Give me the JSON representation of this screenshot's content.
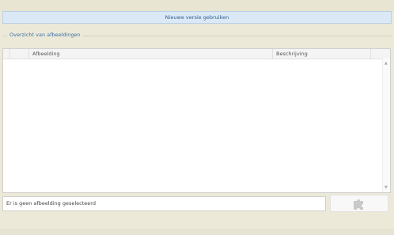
{
  "banner": {
    "label": "Nieuwe versie gebruiken"
  },
  "group": {
    "title": "Overzicht van afbeeldingen"
  },
  "table": {
    "columns": [
      "Afbeelding",
      "Beschrijving"
    ],
    "rows": []
  },
  "status": {
    "text": "Er is geen afbeelding geselecteerd"
  },
  "icons": {
    "plugin_button": "puzzle-piece-icon",
    "scroll_up": "chevron-up-icon",
    "scroll_down": "chevron-down-icon"
  },
  "colors": {
    "background": "#ece9d8",
    "banner_bg": "#dbe9f6",
    "accent_text": "#3a6fa8"
  }
}
